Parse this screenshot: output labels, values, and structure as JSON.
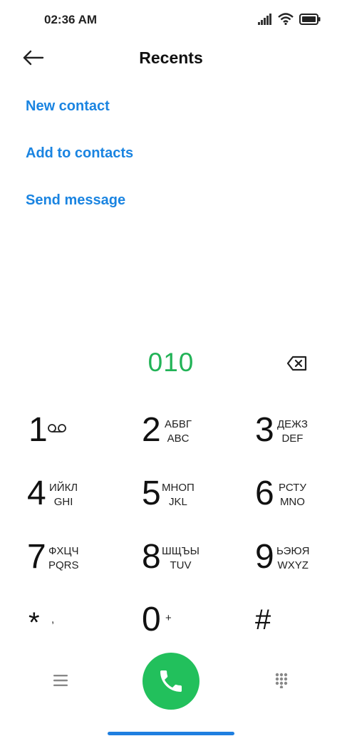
{
  "status_bar": {
    "time": "02:36 AM",
    "icons": [
      "signal-icon",
      "wifi-icon",
      "battery-icon"
    ]
  },
  "header": {
    "title": "Recents",
    "back_icon": "back-arrow-icon"
  },
  "actions": {
    "new_contact": "New contact",
    "add_to_contacts": "Add to contacts",
    "send_message": "Send message"
  },
  "dial": {
    "number": "010",
    "backspace_icon": "backspace-icon"
  },
  "keypad": [
    {
      "digit": "1",
      "top": "",
      "bottom": "",
      "icon": "voicemail-icon"
    },
    {
      "digit": "2",
      "top": "АБВГ",
      "bottom": "ABC"
    },
    {
      "digit": "3",
      "top": "ДЕЖЗ",
      "bottom": "DEF"
    },
    {
      "digit": "4",
      "top": "ИЙКЛ",
      "bottom": "GHI"
    },
    {
      "digit": "5",
      "top": "МНОП",
      "bottom": "JKL"
    },
    {
      "digit": "6",
      "top": "РСТУ",
      "bottom": "MNO"
    },
    {
      "digit": "7",
      "top": "ФХЦЧ",
      "bottom": "PQRS"
    },
    {
      "digit": "8",
      "top": "ШЩЪЫ",
      "bottom": "TUV"
    },
    {
      "digit": "9",
      "top": "ЬЭЮЯ",
      "bottom": "WXYZ"
    },
    {
      "digit": "*",
      "top": ",",
      "bottom": ""
    },
    {
      "digit": "0",
      "top": "+",
      "bottom": ""
    },
    {
      "digit": "#",
      "top": "",
      "bottom": ""
    }
  ],
  "bottom_bar": {
    "menu_icon": "menu-icon",
    "call_icon": "phone-icon",
    "keypad_icon": "dialpad-icon"
  },
  "colors": {
    "accent_blue": "#1a84e1",
    "number_green": "#22b357",
    "call_green": "#22c05c"
  }
}
